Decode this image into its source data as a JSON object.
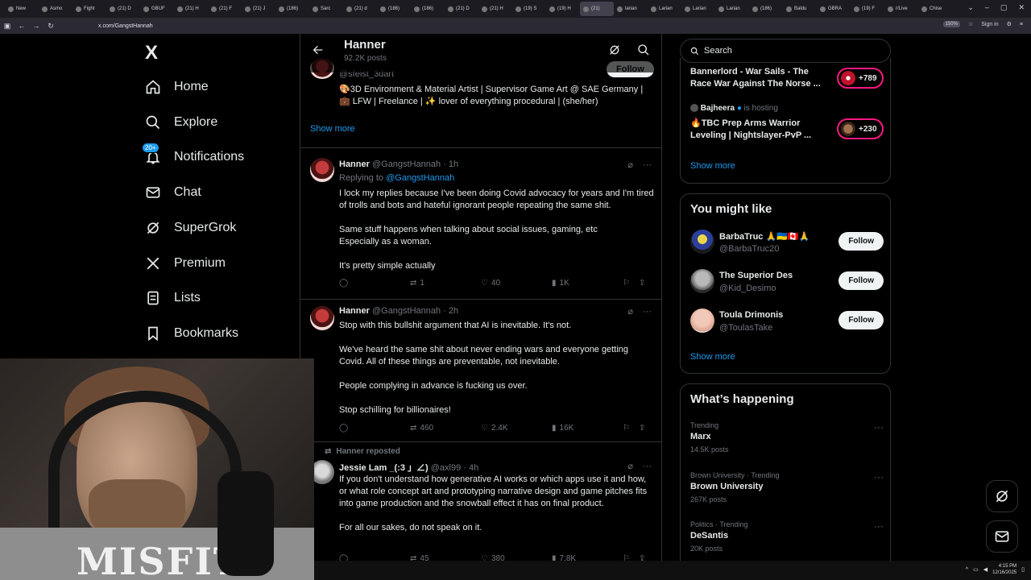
{
  "browser": {
    "tabs": [
      "New",
      "Asmo",
      "Fight",
      "(21) D",
      "GBUF",
      "(21) H",
      "(21) F",
      "(21) J",
      "(186)",
      "Sarc",
      "(21) d",
      "(186)",
      "(186)",
      "(21) D",
      "(21) H",
      "(19) S",
      "(19) H",
      "(21)",
      "larian",
      "Larian",
      "Larian",
      "Larian",
      "(186)",
      "Baldu",
      "GBRA",
      "(19) F",
      "r/Live",
      "Chise"
    ],
    "active_tab_index": 17,
    "url": "x.com/GangstHannah",
    "zoom": "150%",
    "sign_in": "Sign in"
  },
  "nav": {
    "logo": "X",
    "items": [
      {
        "label": "Home",
        "icon": "home-icon"
      },
      {
        "label": "Explore",
        "icon": "search-icon"
      },
      {
        "label": "Notifications",
        "icon": "bell-icon",
        "badge": "20+"
      },
      {
        "label": "Chat",
        "icon": "mail-icon"
      },
      {
        "label": "SuperGrok",
        "icon": "grok-icon"
      },
      {
        "label": "Premium",
        "icon": "x-icon"
      },
      {
        "label": "Lists",
        "icon": "list-icon"
      },
      {
        "label": "Bookmarks",
        "icon": "bookmark-icon"
      }
    ]
  },
  "header": {
    "name": "Hanner",
    "posts_count": "92.2K posts"
  },
  "top_card": {
    "follow_label": "Follow",
    "handle": "@sfeist_3dart",
    "bio": "🎨3D Environment & Material Artist | Supervisor Game Art @ SAE Germany | 💼 LFW | Freelance | ✨ lover of everything procedural | (she/her)",
    "show_more": "Show more"
  },
  "tweets": [
    {
      "name": "Hanner",
      "handle": "@GangstHannah · 1h",
      "reply_prefix": "Replying to",
      "reply_to": "@GangstHannah",
      "lines": [
        "I lock my replies because I've been doing Covid advocacy for years and I'm tired of trolls and bots and hateful ignorant people repeating the same shit.",
        "Same stuff happens when talking about social issues, gaming, etc",
        "Especially as a woman.",
        "It's pretty simple actually"
      ],
      "replies": "",
      "reposts": "1",
      "likes": "40",
      "views": "1K"
    },
    {
      "name": "Hanner",
      "handle": "@GangstHannah · 2h",
      "lines": [
        "Stop with this bullshit argument that AI is inevitable. It's not.",
        "We've heard the same shit about never ending wars and everyone getting Covid. All of these things are preventable, not inevitable.",
        "People complying in advance is fucking us over.",
        "Stop schilling for billionaires!"
      ],
      "replies": "",
      "reposts": "460",
      "likes": "2.4K",
      "views": "16K"
    },
    {
      "repost_label": "Hanner reposted",
      "name": "Jessie Lam _(:3 」∠)",
      "handle": "@axl99 · 4h",
      "lines": [
        "If you don't understand how generative AI works or which apps use it and how, or what role concept art and prototyping narrative design and game pitches fits into game production and the snowball effect it has on final product.",
        "For all our sakes, do not speak on it."
      ],
      "replies": "",
      "reposts": "45",
      "likes": "380",
      "views": "7.8K"
    }
  ],
  "right": {
    "search_placeholder": "Search",
    "spaces": [
      {
        "title": "Bannerlord - War Sails - The Race War Against The Norse ...",
        "count": "+789"
      },
      {
        "host_name": "Bajheera",
        "host_suffix": "is hosting",
        "title": "🔥TBC Prep Arms Warrior Leveling | Nightslayer-PvP ...",
        "count": "+230"
      }
    ],
    "spaces_show_more": "Show more",
    "wtf_title": "You might like",
    "wtf": [
      {
        "name": "BarbaTruc 🙏🇺🇦🇨🇦🙏",
        "handle": "@BarbaTruc20",
        "button": "Follow"
      },
      {
        "name": "The Superior Des",
        "handle": "@Kid_Desimo",
        "button": "Follow"
      },
      {
        "name": "Toula Drimonis",
        "handle": "@ToulasTake",
        "button": "Follow"
      }
    ],
    "wtf_show_more": "Show more",
    "trends_title": "What’s happening",
    "trends": [
      {
        "category": "Trending",
        "name": "Marx",
        "count": "14.5K posts"
      },
      {
        "category": "Brown University · Trending",
        "name": "Brown University",
        "count": "267K posts"
      },
      {
        "category": "Politics · Trending",
        "name": "DeSantis",
        "count": "20K posts"
      }
    ]
  },
  "webcam": {
    "shirt_text": "MISFITS"
  },
  "taskbar": {
    "time": "4:15 PM",
    "date": "12/16/2025"
  },
  "colors": {
    "accent": "#1d9bf0",
    "border": "#2f3336",
    "muted": "#71767b",
    "live": "#f91880"
  }
}
